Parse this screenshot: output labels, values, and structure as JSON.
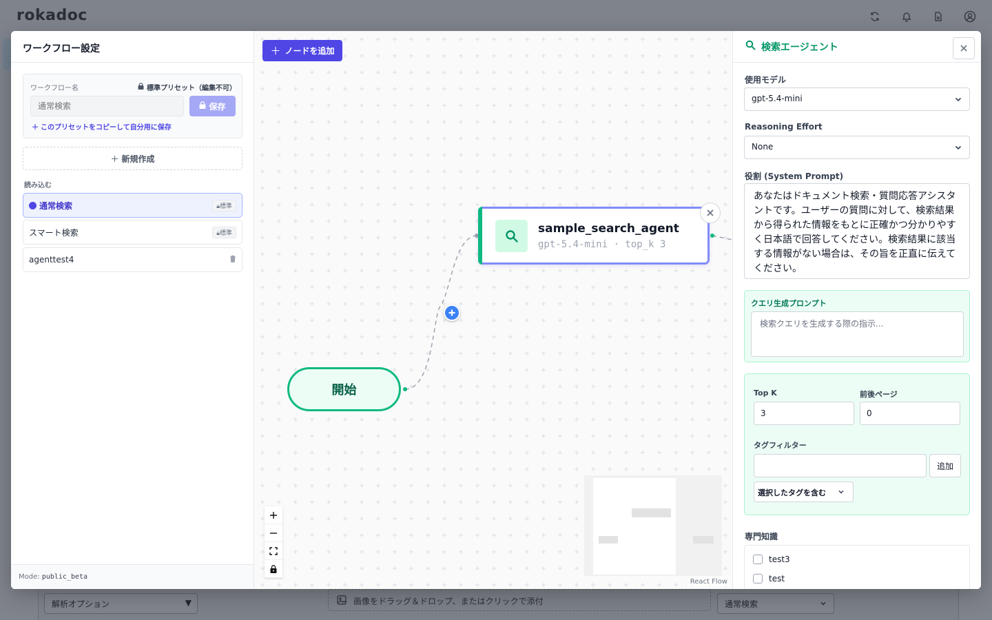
{
  "app": {
    "logo": "rokadoc",
    "icons": [
      "refresh-icon",
      "bell-icon",
      "document-icon",
      "account-icon"
    ]
  },
  "background": {
    "analysis_option": "解析オプション",
    "image_drop": "画像をドラッグ＆ドロップ、またはクリックで添付",
    "search_mode": "通常検索"
  },
  "left_panel": {
    "title": "ワークフロー設定",
    "workflow_name_label": "ワークフロー名",
    "preset_note": "標準プリセット（編集不可）",
    "name_placeholder": "通常検索",
    "save_label": "保存",
    "copy_label": "このプリセットをコピーして自分用に保存",
    "new_label": "新規作成",
    "load_label": "読み込む",
    "items": [
      {
        "label": "通常検索",
        "badge": "標準",
        "active": true
      },
      {
        "label": "スマート検索",
        "badge": "標準",
        "active": false
      },
      {
        "label": "agenttest4",
        "badge": "",
        "active": false
      }
    ],
    "mode_label": "Mode:",
    "mode_value": "public_beta"
  },
  "canvas": {
    "add_node_label": "ノードを追加",
    "start_node_label": "開始",
    "agent_node": {
      "title": "sample_search_agent",
      "subtitle": "gpt-5.4-mini · top_k 3"
    },
    "attribution": "React Flow"
  },
  "right_panel": {
    "title": "検索エージェント",
    "model_label": "使用モデル",
    "model_value": "gpt-5.4-mini",
    "effort_label": "Reasoning Effort",
    "effort_value": "None",
    "role_label": "役割 (System Prompt)",
    "role_value": "あなたはドキュメント検索・質問応答アシスタントです。ユーザーの質問に対して、検索結果から得られた情報をもとに正確かつ分かりやすく日本語で回答してください。検索結果に該当する情報がない場合は、その旨を正直に伝えてください。",
    "query_prompt_label": "クエリ生成プロンプト",
    "query_prompt_placeholder": "検索クエリを生成する際の指示...",
    "topk_label": "Top K",
    "topk_value": "3",
    "pages_label": "前後ページ",
    "pages_value": "0",
    "tag_filter_label": "タグフィルター",
    "tag_filter_value": "",
    "add_label": "追加",
    "tag_mode_value": "選択したタグを含む",
    "knowledge_label": "専門知識",
    "knowledge_items": [
      "test3",
      "test"
    ]
  },
  "colors": {
    "accent": "#4f46e5",
    "green": "#10b981",
    "node_border": "#818cf8"
  }
}
